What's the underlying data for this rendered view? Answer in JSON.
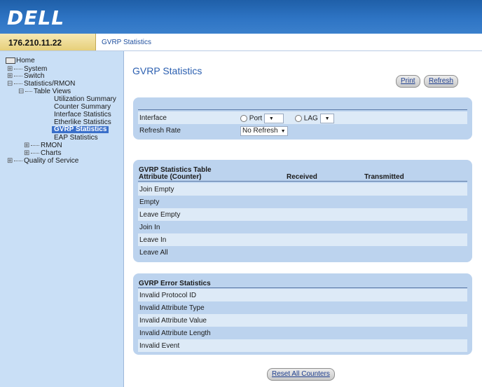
{
  "header": {
    "logo_text": "DELL",
    "ip_address": "176.210.11.22",
    "breadcrumb": "GVRP Statistics"
  },
  "sidebar": {
    "items": [
      {
        "label": "Home",
        "toggle": ""
      },
      {
        "label": "System",
        "toggle": "⊞"
      },
      {
        "label": "Switch",
        "toggle": "⊞"
      },
      {
        "label": "Statistics/RMON",
        "toggle": "⊟"
      },
      {
        "label": "Table Views",
        "toggle": "⊟"
      },
      {
        "label": "Utilization Summary",
        "toggle": ""
      },
      {
        "label": "Counter Summary",
        "toggle": ""
      },
      {
        "label": "Interface Statistics",
        "toggle": ""
      },
      {
        "label": "Etherlike Statistics",
        "toggle": ""
      },
      {
        "label": "GVRP Statistics",
        "toggle": ""
      },
      {
        "label": "EAP Statistics",
        "toggle": ""
      },
      {
        "label": "RMON",
        "toggle": "⊞"
      },
      {
        "label": "Charts",
        "toggle": "⊞"
      },
      {
        "label": "Quality of Service",
        "toggle": "⊞"
      }
    ]
  },
  "main": {
    "title": "GVRP Statistics",
    "print_label": "Print",
    "refresh_label": "Refresh",
    "interface_label": "Interface",
    "port_label": "Port",
    "lag_label": "LAG",
    "port_value": "",
    "lag_value": "",
    "refresh_rate_label": "Refresh Rate",
    "refresh_rate_value": "No Refresh",
    "stats_table": {
      "title": "GVRP Statistics Table",
      "col_attribute": "Attribute (Counter)",
      "col_received": "Received",
      "col_transmitted": "Transmitted",
      "rows": [
        "Join Empty",
        "Empty",
        "Leave Empty",
        "Join In",
        "Leave In",
        "Leave All"
      ]
    },
    "error_table": {
      "title": "GVRP Error Statistics",
      "rows": [
        "Invalid Protocol ID",
        "Invalid Attribute Type",
        "Invalid Attribute Value",
        "Invalid Attribute Length",
        "Invalid Event"
      ]
    },
    "reset_label": "Reset All Counters"
  },
  "colors": {
    "banner": "#2e74c4",
    "sidebar": "#c9dff6",
    "panel": "#bcd3ee",
    "row_light": "#ddeaf7",
    "title_blue": "#2b5fb0"
  }
}
